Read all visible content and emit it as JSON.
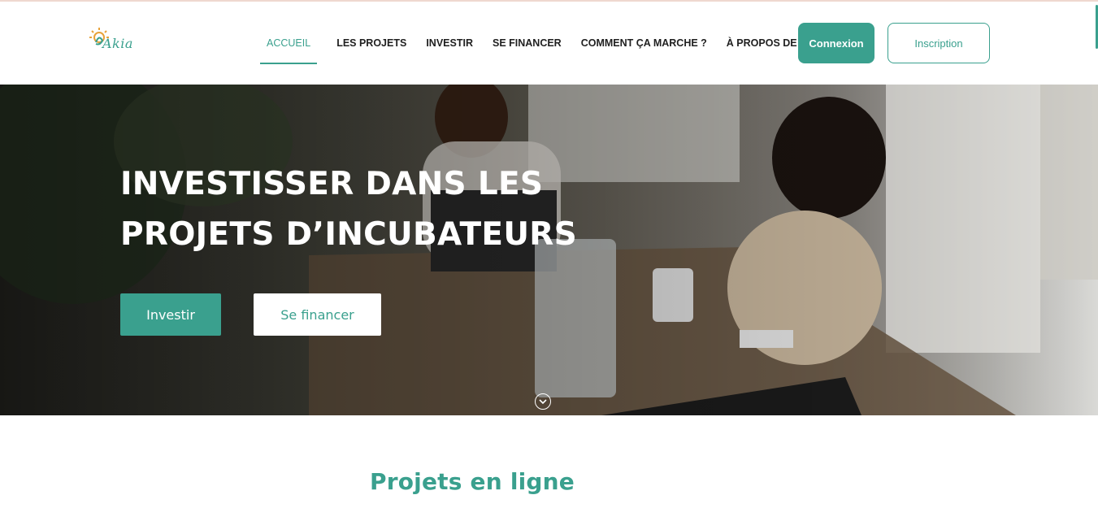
{
  "header": {
    "logo_text": "Akia",
    "nav": [
      {
        "label": "ACCUEIL",
        "active": true
      },
      {
        "label": "LES PROJETS",
        "active": false
      },
      {
        "label": "INVESTIR",
        "active": false
      },
      {
        "label": "SE FINANCER",
        "active": false
      },
      {
        "label": "COMMENT ÇA MARCHE ?",
        "active": false
      },
      {
        "label": "À PROPOS DE NOUS",
        "active": false
      }
    ],
    "connexion_label": "Connexion",
    "inscription_label": "Inscription"
  },
  "hero": {
    "title_line1": "INVESTISSER DANS LES",
    "title_line2": "PROJETS D’INCUBATEURS",
    "investir_label": "Investir",
    "financer_label": "Se financer"
  },
  "section": {
    "title": "Projets en ligne"
  },
  "colors": {
    "accent": "#3aa08e",
    "text_dark": "#1f1f1f",
    "white": "#ffffff"
  },
  "icons": {
    "scroll_down": "chevron-down-circle-icon",
    "logo": "sun-logo-icon"
  }
}
